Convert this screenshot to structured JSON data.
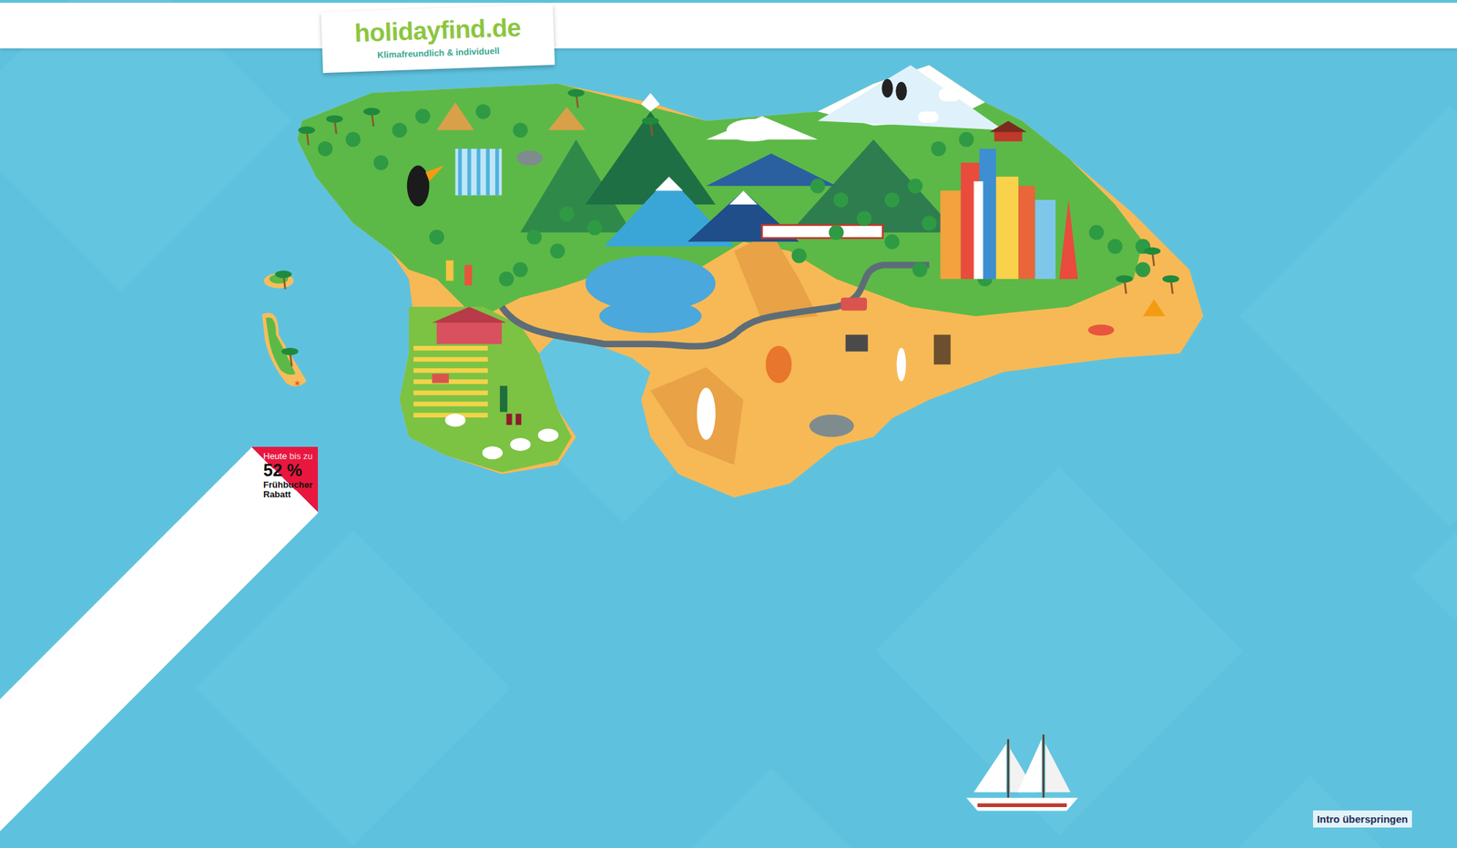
{
  "logo": {
    "name": "holidayfind.de",
    "tagline": "Klimafreundlich & individuell"
  },
  "badge": {
    "line1_a": "Heute",
    "line1_b": "bis zu",
    "value": "52 %",
    "label1": "Frühbucher",
    "label2": "Rabatt"
  },
  "skip_button": {
    "label": "Intro überspringen"
  }
}
